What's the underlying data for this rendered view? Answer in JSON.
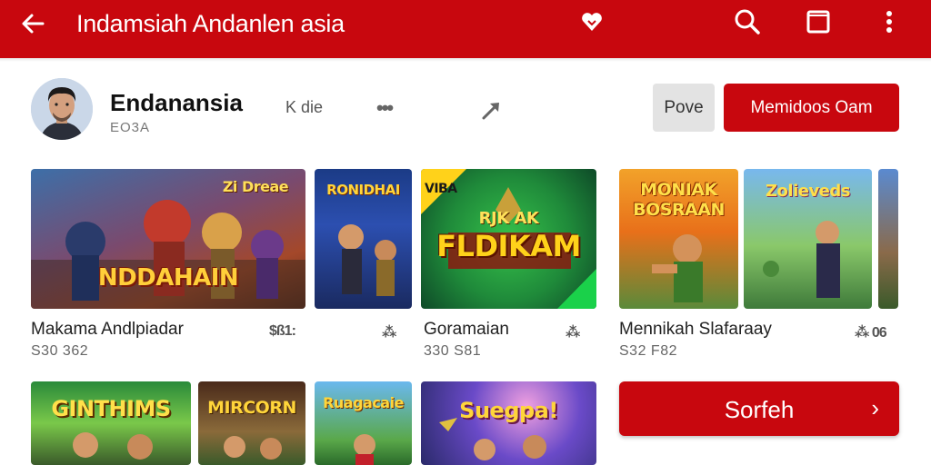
{
  "appbar": {
    "title": "Indamsiah Andanlen asia",
    "icons": [
      "back-arrow-icon",
      "heart-icon",
      "search-icon",
      "square-icon",
      "more-vert-icon"
    ]
  },
  "developer": {
    "name": "Endanansia",
    "sub": "EO3A",
    "link": "K die",
    "dots": "•••",
    "share_icon": "share-arrow-icon"
  },
  "buttons": {
    "secondary": "Pove",
    "primary": "Memidoos Oam"
  },
  "cards_row1": [
    {
      "art": "NDDAHAIN",
      "badge": "Zi Dreae"
    },
    {
      "art": "RONIDHAI"
    },
    {
      "art": "FLDIKAM",
      "corner": "VIBA",
      "top": "RJK AK"
    },
    {
      "art": "MONIAK BOSRAAN"
    },
    {
      "art": "Zolieveds"
    }
  ],
  "labels_row1": [
    {
      "title": "Makama Andlpiadar",
      "sub": "S30 362",
      "rating": "$ß1:"
    },
    {
      "title": "Goramaian",
      "sub": "330 S81",
      "rating": "⁂"
    },
    {
      "title": "Mennikah Slafaraay",
      "sub": "S32 F82",
      "rating": "⁂ 06"
    }
  ],
  "cards_row2": [
    {
      "art": "GINTHIMS"
    },
    {
      "art": "MIRCORN"
    },
    {
      "art": "Ruagacaie"
    },
    {
      "art": "Suegpa!"
    }
  ],
  "search_button": {
    "label": "Sorfeh",
    "chevron": "›"
  },
  "colors": {
    "brand_red": "#c8070e",
    "background": "#ffffff"
  }
}
